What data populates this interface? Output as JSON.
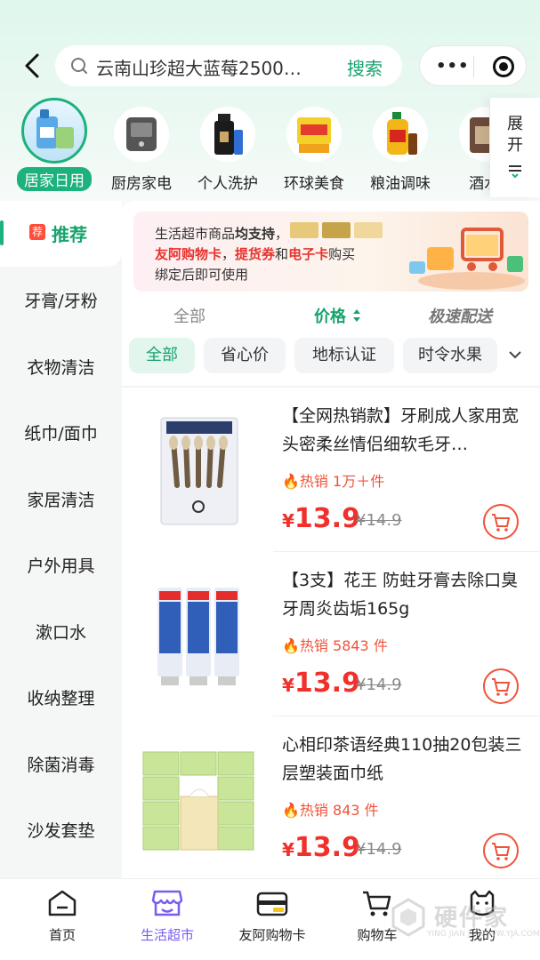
{
  "header": {
    "search_query": "云南山珍超大蓝莓2500…",
    "search_button": "搜索"
  },
  "categories": [
    {
      "label": "居家日用",
      "selected": true
    },
    {
      "label": "厨房家电",
      "selected": false
    },
    {
      "label": "个人洗护",
      "selected": false
    },
    {
      "label": "环球美食",
      "selected": false
    },
    {
      "label": "粮油调味",
      "selected": false
    },
    {
      "label": "酒水/",
      "selected": false
    }
  ],
  "expand_label": "展开",
  "sidebar": {
    "active": {
      "tag": "荐",
      "label": "推荐"
    },
    "items": [
      "牙膏/牙粉",
      "衣物清洁",
      "纸巾/面巾",
      "家居清洁",
      "户外用具",
      "漱口水",
      "收纳整理",
      "除菌消毒",
      "沙发套垫"
    ]
  },
  "banner": {
    "l1_a": "生活超市商品",
    "l1_b": "均支持",
    "l1_c": "，",
    "l2_a": "友阿购物卡",
    "l2_b": "，",
    "l2_c": "提货券",
    "l2_d": "和",
    "l2_e": "电子卡",
    "l2_f": "购买",
    "l3": "绑定后即可使用"
  },
  "sort": {
    "all": "全部",
    "price": "价格",
    "fast": "极速配送"
  },
  "filters": [
    "全部",
    "省心价",
    "地标认证",
    "时令水果"
  ],
  "products": [
    {
      "title": "【全网热销款】牙刷成人家用宽头密柔丝情侣细软毛牙…",
      "hot": "热销 1万＋件",
      "currency": "¥",
      "price": "13.9",
      "old_price": "¥14.9"
    },
    {
      "title": "【3支】花王 防蛀牙膏去除口臭牙周炎齿垢165g",
      "hot": "热销 5843 件",
      "currency": "¥",
      "price": "13.9",
      "old_price": "¥14.9"
    },
    {
      "title": "心相印茶语经典110抽20包装三层塑装面巾纸",
      "hot": "热销 843 件",
      "currency": "¥",
      "price": "13.9",
      "old_price": "¥14.9"
    }
  ],
  "tabs": [
    "首页",
    "生活超市",
    "友阿购物卡",
    "购物车",
    "我的"
  ],
  "watermark": {
    "name": "硬件家",
    "url": "YING JIAN JIA WWW.YJA.COM"
  },
  "colors": {
    "accent": "#1cb17d",
    "price": "#f0302a",
    "tab_active": "#7b5cf2"
  }
}
